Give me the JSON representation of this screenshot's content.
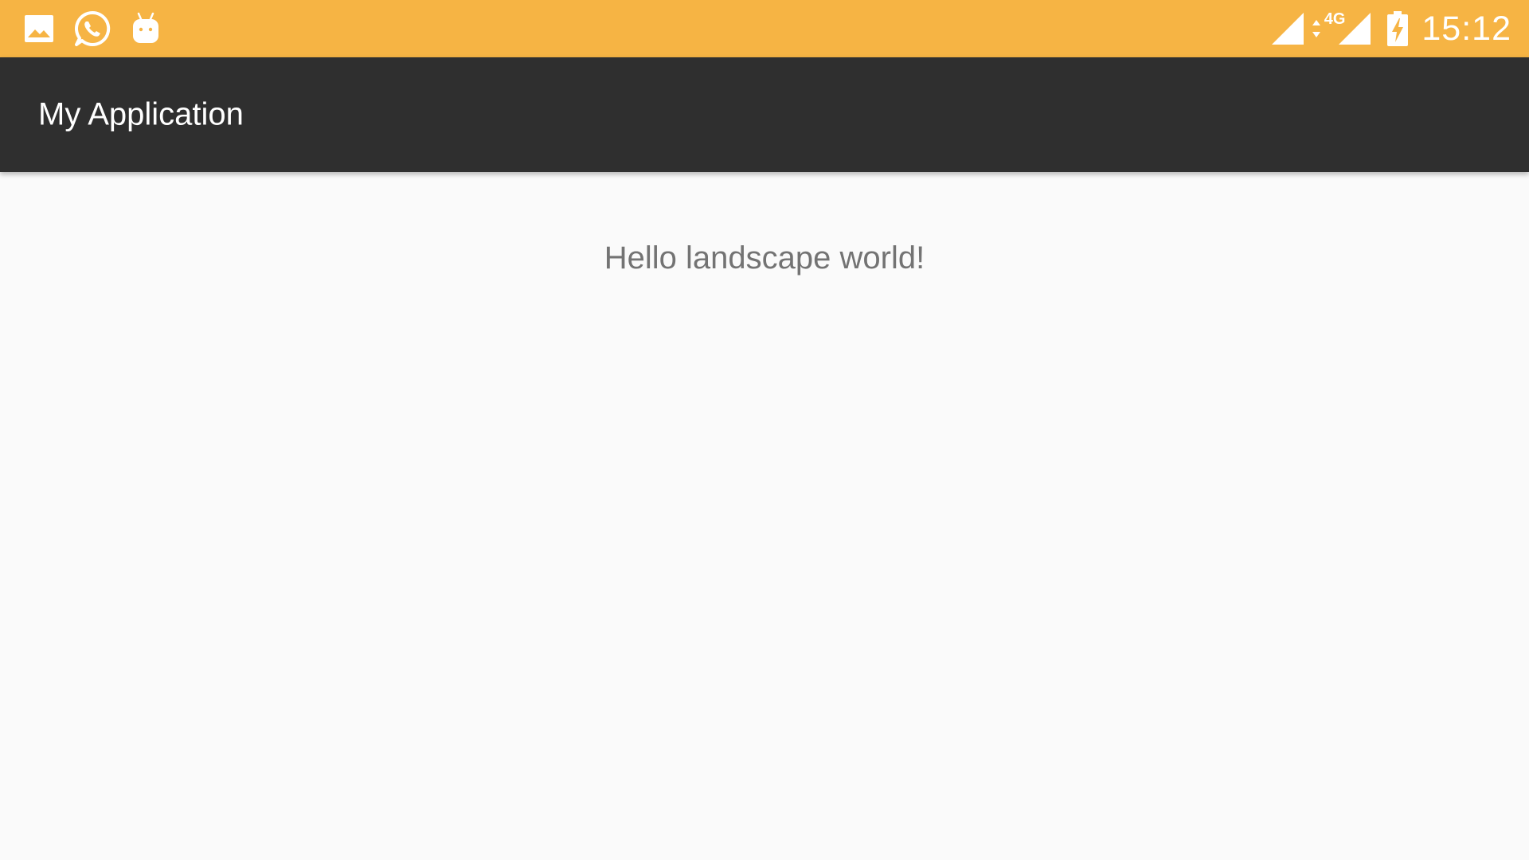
{
  "status_bar": {
    "background_color": "#f6b444",
    "left_icons": [
      "gallery-icon",
      "whatsapp-icon",
      "android-icon"
    ],
    "network_type": "4G",
    "time": "15:12",
    "right_icons": [
      "cellular-signal-icon",
      "data-activity-icon",
      "cellular-signal-icon",
      "battery-charging-icon"
    ]
  },
  "app_bar": {
    "background_color": "#2f2f2f",
    "title": "My Application"
  },
  "content": {
    "background_color": "#fafafa",
    "message": "Hello landscape world!"
  }
}
